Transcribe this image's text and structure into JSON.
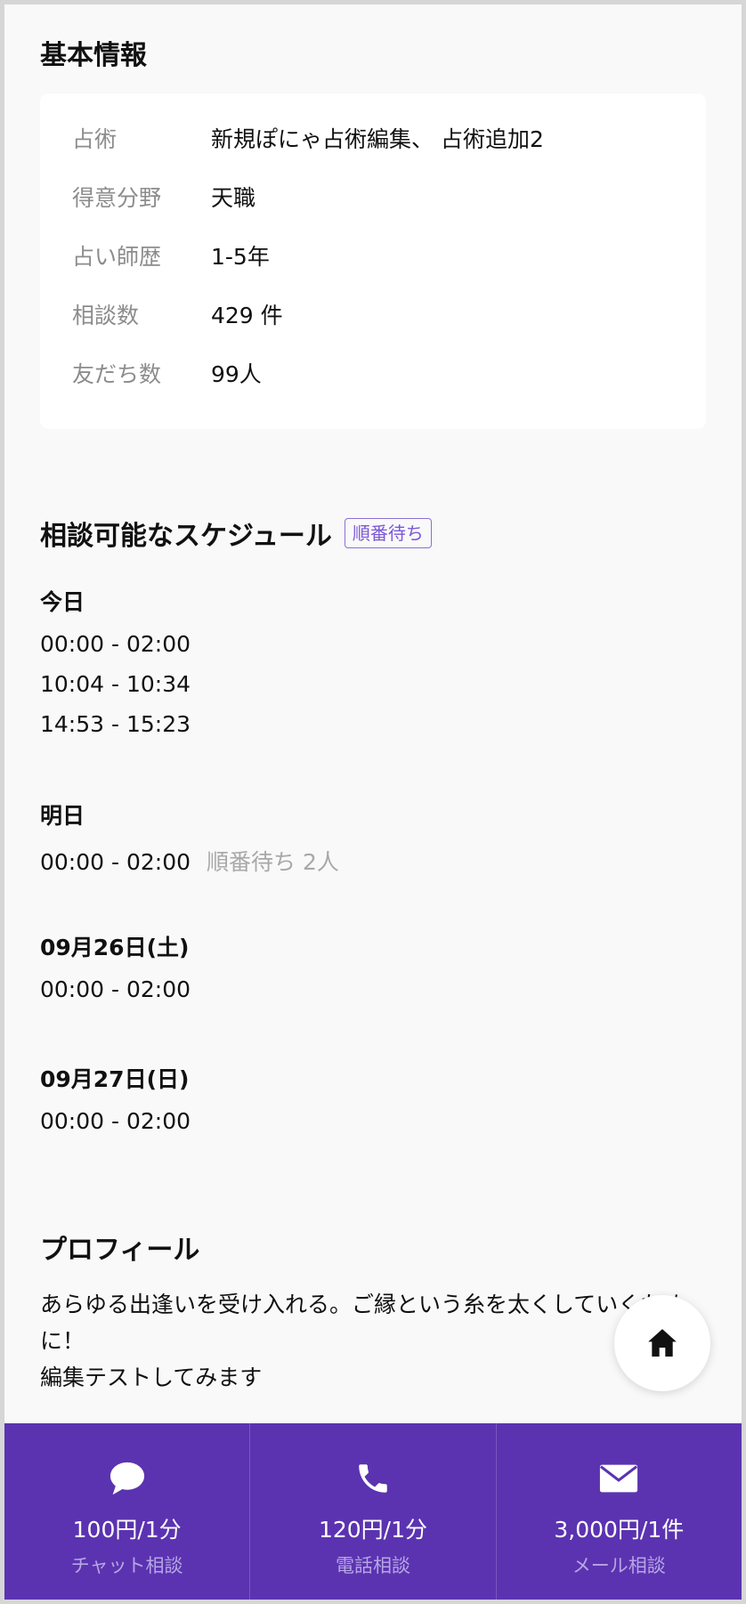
{
  "basic_info": {
    "heading": "基本情報",
    "rows": [
      {
        "label": "占術",
        "value": "新規ぽにゃ占術編集、 占術追加2"
      },
      {
        "label": "得意分野",
        "value": "天職"
      },
      {
        "label": "占い師歴",
        "value": "1-5年"
      },
      {
        "label": "相談数",
        "value": "429 件"
      },
      {
        "label": "友だち数",
        "value": "99人"
      }
    ]
  },
  "schedule": {
    "heading": "相談可能なスケジュール",
    "badge": "順番待ち",
    "days": [
      {
        "label": "今日",
        "slots": [
          {
            "time": "00:00 - 02:00",
            "wait": ""
          },
          {
            "time": "10:04 - 10:34",
            "wait": ""
          },
          {
            "time": "14:53 - 15:23",
            "wait": ""
          }
        ]
      },
      {
        "label": "明日",
        "slots": [
          {
            "time": "00:00 - 02:00",
            "wait": "順番待ち 2人"
          }
        ]
      },
      {
        "label": "09月26日(土)",
        "slots": [
          {
            "time": "00:00 - 02:00",
            "wait": ""
          }
        ]
      },
      {
        "label": "09月27日(日)",
        "slots": [
          {
            "time": "00:00 - 02:00",
            "wait": ""
          }
        ]
      }
    ]
  },
  "profile": {
    "heading": "プロフィール",
    "lines": [
      "あらゆる出逢いを受け入れる。ご縁という糸を太くしていくために！",
      "編集テストしてみます"
    ]
  },
  "home_button": {
    "icon": "home-icon"
  },
  "bottom_bar": {
    "items": [
      {
        "icon": "chat-bubble-icon",
        "price": "100円/1分",
        "label": "チャット相談"
      },
      {
        "icon": "phone-icon",
        "price": "120円/1分",
        "label": "電話相談"
      },
      {
        "icon": "mail-icon",
        "price": "3,000円/1件",
        "label": "メール相談"
      }
    ],
    "background": "#5b33b0"
  }
}
